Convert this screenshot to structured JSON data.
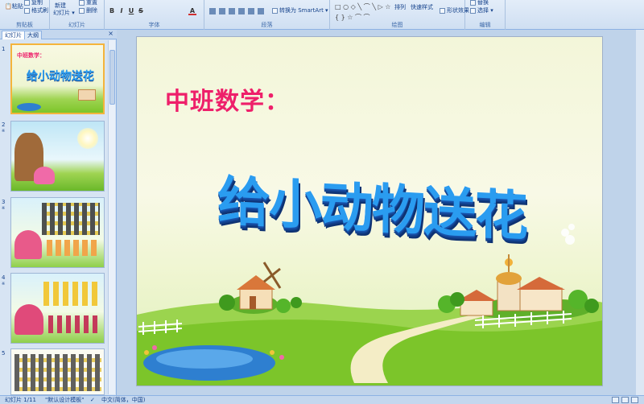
{
  "ribbon": {
    "clipboard": {
      "label": "剪贴板",
      "paste": "粘贴",
      "copy": "复制",
      "format_painter": "格式刷"
    },
    "slides": {
      "label": "幻灯片",
      "new_slide": "新建",
      "new_slide_2": "幻灯片",
      "reset": "重置",
      "delete": "删除"
    },
    "font": {
      "label": "字体",
      "buttons": [
        "B",
        "I",
        "U",
        "S",
        "A"
      ]
    },
    "paragraph": {
      "label": "段落",
      "convert_smartart": "转换为 SmartArt"
    },
    "drawing": {
      "label": "绘图",
      "arrange": "排列",
      "quick_styles": "快速样式",
      "shape_effects": "形状效果"
    },
    "editing": {
      "label": "编辑",
      "replace": "替换",
      "select": "选择"
    }
  },
  "left_pane": {
    "tabs": [
      "幻灯片",
      "大纲"
    ],
    "close": "×",
    "thumbnails": [
      {
        "number": "1",
        "subtitle": "中班数学：",
        "title": "给小动物送花"
      },
      {
        "number": "2",
        "anim": "※"
      },
      {
        "number": "3",
        "anim": "※"
      },
      {
        "number": "4",
        "anim": "※"
      },
      {
        "number": "5"
      }
    ]
  },
  "slide": {
    "subtitle": "中班数学：",
    "title": "给小动物送花"
  },
  "status_bar": {
    "slide_pos": "幻灯片 1/11",
    "theme": "\"默认设计模板\"",
    "language": "中文(简体，中国)"
  },
  "colors": {
    "subtitle": "#ee1f6a",
    "title": "#2a9cf0",
    "title_shadow": "#1750a8",
    "grass": "#7cc52a",
    "sky": "#f3f6d9",
    "pond": "#2e7fd0"
  }
}
